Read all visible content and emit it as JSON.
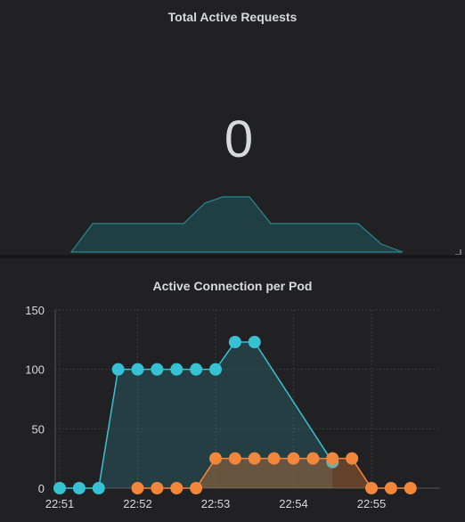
{
  "stat_panel": {
    "title": "Total Active Requests",
    "value": "0",
    "sparkline_color": "#1f6b73"
  },
  "chart_data": {
    "type": "line",
    "title": "Active Connection per Pod",
    "xlabel": "",
    "ylabel": "",
    "x_ticks": [
      "22:51",
      "22:52",
      "22:53",
      "22:54",
      "22:55"
    ],
    "y_ticks": [
      0,
      50,
      100,
      150
    ],
    "ylim": [
      0,
      150
    ],
    "grid": true,
    "series": [
      {
        "color": "#37c2d4",
        "fill": true,
        "x": [
          "22:51:00",
          "22:51:15",
          "22:51:30",
          "22:51:45",
          "22:52:00",
          "22:52:15",
          "22:52:30",
          "22:52:45",
          "22:53:00",
          "22:53:15",
          "22:53:30",
          "22:54:30"
        ],
        "values": [
          0,
          0,
          0,
          100,
          100,
          100,
          100,
          100,
          100,
          123,
          123,
          22
        ]
      },
      {
        "color": "#f2863a",
        "fill": true,
        "x": [
          "22:52:00",
          "22:52:15",
          "22:52:30",
          "22:52:45",
          "22:53:00",
          "22:53:15",
          "22:53:30",
          "22:53:45",
          "22:54:00",
          "22:54:15",
          "22:54:30",
          "22:54:45",
          "22:55:00",
          "22:55:15",
          "22:55:30"
        ],
        "values": [
          0,
          0,
          0,
          0,
          25,
          25,
          25,
          25,
          25,
          25,
          25,
          25,
          0,
          0,
          0
        ]
      }
    ]
  }
}
